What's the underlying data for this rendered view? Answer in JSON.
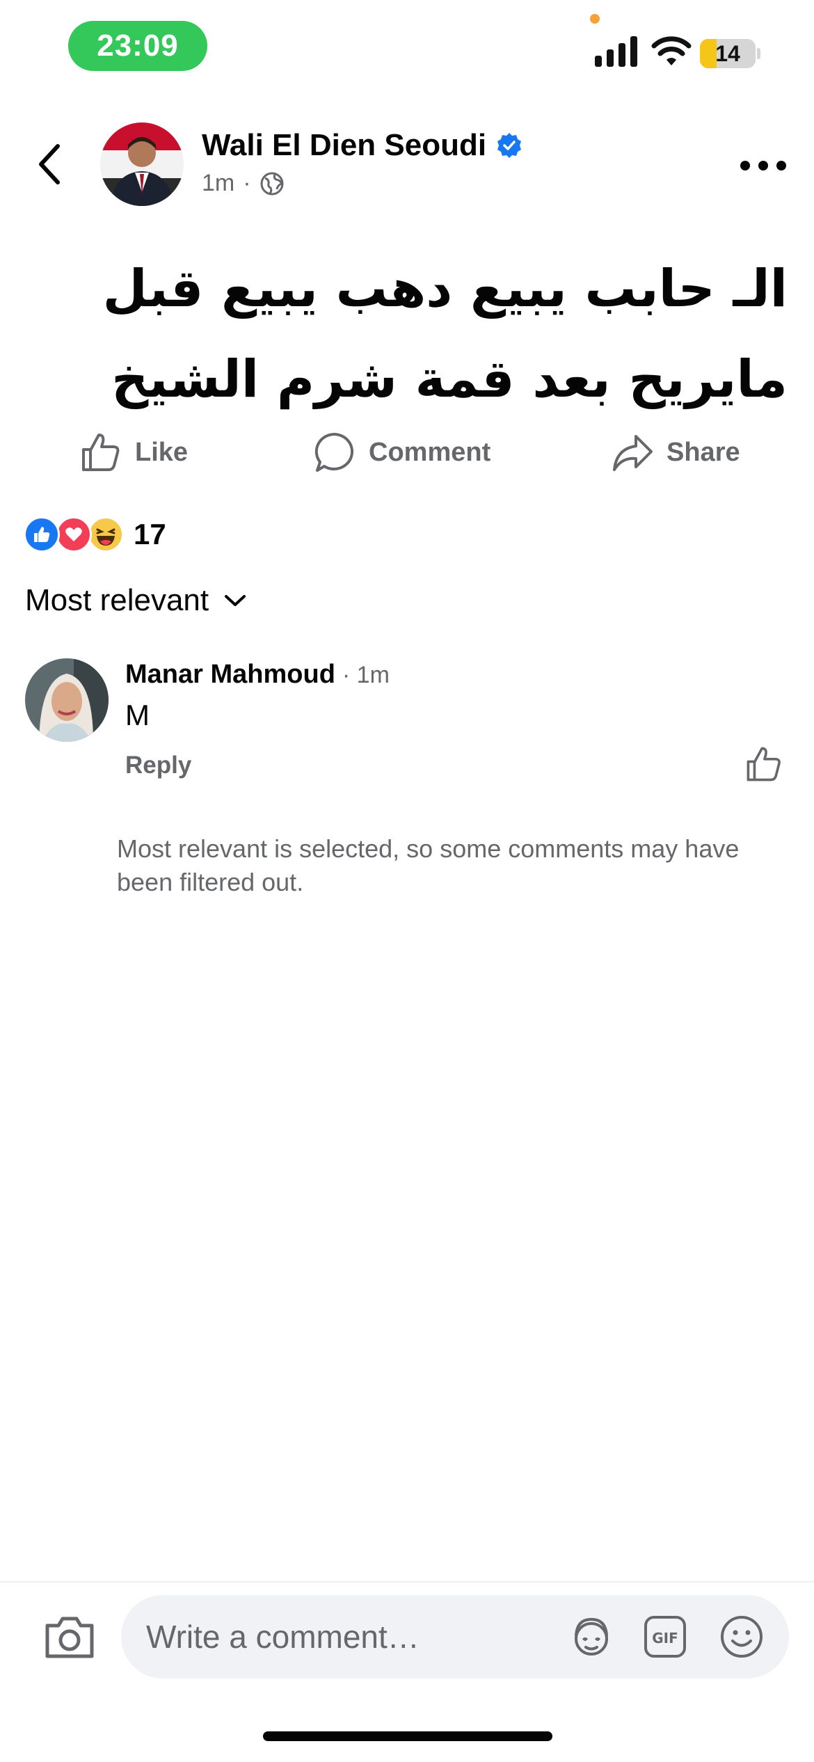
{
  "status_bar": {
    "time": "23:09",
    "battery_level": "14",
    "icons": [
      "cellular-signal-icon",
      "wifi-icon",
      "battery-icon"
    ]
  },
  "post": {
    "author": "Wali El Dien Seoudi",
    "verified": true,
    "time": "1m",
    "separator": "·",
    "audience_icon": "globe-icon",
    "text_line1": "الـ حابب يبيع دهب يبيع قبل",
    "text_line2": "مايريح بعد قمة شرم الشيخ"
  },
  "actions": {
    "like": "Like",
    "comment": "Comment",
    "share": "Share"
  },
  "reactions": {
    "types": [
      "like",
      "love",
      "haha"
    ],
    "count": "17"
  },
  "sort": {
    "label": "Most relevant"
  },
  "comments": [
    {
      "name": "Manar Mahmoud",
      "time": "· 1m",
      "text": "M",
      "reply_label": "Reply"
    }
  ],
  "filter_note": "Most relevant is selected, so some comments may have been filtered out.",
  "composer": {
    "placeholder": "Write a comment…",
    "gif_label": "GIF"
  },
  "colors": {
    "accent": "#1877f2",
    "muted_text": "#65676b",
    "time_pill": "#34c759",
    "love": "#f33e58",
    "haha": "#f7c94b",
    "battery_fill": "#f5c518"
  }
}
